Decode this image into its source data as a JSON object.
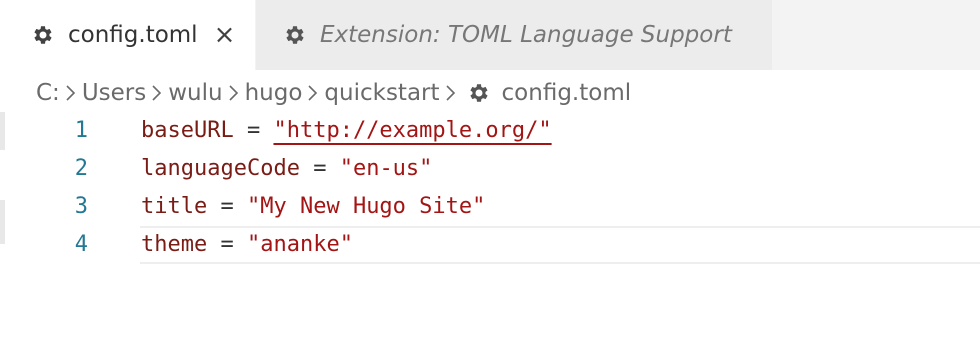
{
  "tabs": [
    {
      "label": "config.toml",
      "active": true,
      "icon": "gear-icon",
      "close_icon": "×"
    },
    {
      "label": "Extension: TOML Language Support",
      "active": false,
      "icon": "gear-icon"
    }
  ],
  "breadcrumb": [
    "C:",
    "Users",
    "wulu",
    "hugo",
    "quickstart",
    "config.toml"
  ],
  "editor": {
    "lines": [
      {
        "number": "1",
        "key": "baseURL",
        "op": " = ",
        "value": "\"http://example.org/\""
      },
      {
        "number": "2",
        "key": "languageCode",
        "op": " = ",
        "value": "\"en-us\""
      },
      {
        "number": "3",
        "key": "title",
        "op": " = ",
        "value": "\"My New Hugo Site\""
      },
      {
        "number": "4",
        "key": "theme",
        "op": " = ",
        "value": "\"ananke\""
      }
    ]
  },
  "colors": {
    "line_number": "#237893",
    "key": "#7a1c16",
    "string": "#a31515",
    "tab_bar": "#f3f3f3"
  }
}
